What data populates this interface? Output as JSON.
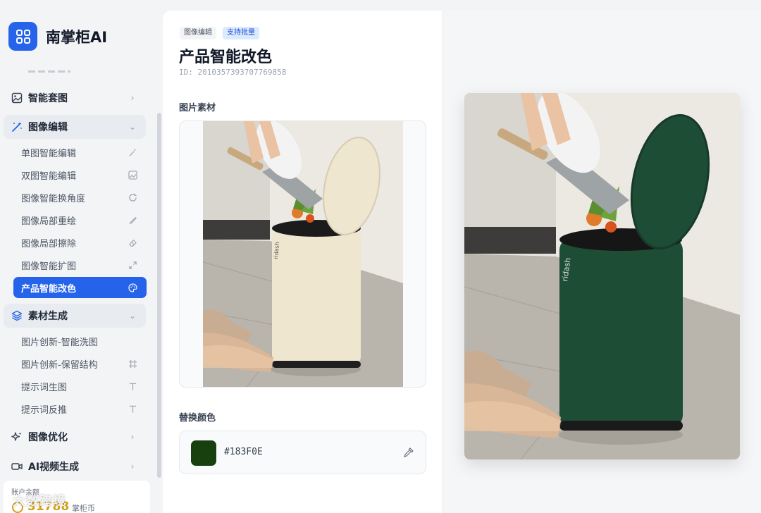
{
  "app": {
    "name": "南掌柜AI",
    "accent": "#2563eb"
  },
  "sidebar": {
    "groups": [
      {
        "label": "智能套图",
        "icon": "image-icon"
      },
      {
        "label": "图像编辑",
        "icon": "magic-wand-icon"
      },
      {
        "label": "素材生成",
        "icon": "layers-icon"
      },
      {
        "label": "图像优化",
        "icon": "sparkle-icon"
      },
      {
        "label": "AI视频生成",
        "icon": "video-icon"
      }
    ],
    "image_edit_items": [
      {
        "label": "单图智能编辑",
        "icon": "wand-icon"
      },
      {
        "label": "双图智能编辑",
        "icon": "image-icon"
      },
      {
        "label": "图像智能换角度",
        "icon": "rotate-icon"
      },
      {
        "label": "图像局部重绘",
        "icon": "brush-icon"
      },
      {
        "label": "图像局部擦除",
        "icon": "eraser-icon"
      },
      {
        "label": "图像智能扩图",
        "icon": "expand-icon"
      },
      {
        "label": "产品智能改色",
        "icon": "palette-icon",
        "active": true
      }
    ],
    "material_items": [
      {
        "label": "图片创新-智能洗图",
        "icon": ""
      },
      {
        "label": "图片创新-保留结构",
        "icon": "crop-icon"
      },
      {
        "label": "提示词生图",
        "icon": "text-icon"
      },
      {
        "label": "提示词反推",
        "icon": "text-icon"
      }
    ],
    "balance": {
      "title": "账户余额",
      "value": "31788",
      "unit": "掌柜币"
    }
  },
  "panel": {
    "tags": [
      "图像编辑",
      "支持批量"
    ],
    "title": "产品智能改色",
    "id_text": "ID: 2010357393707769858",
    "source_label": "图片素材",
    "color_label": "替换颜色",
    "color": {
      "hex_text": "#183F0E",
      "swatch": "#183F0E"
    }
  },
  "colors": {
    "original_bin": "#efe6cf",
    "result_bin": "#1e4d35"
  },
  "watermark": "大数跨境"
}
